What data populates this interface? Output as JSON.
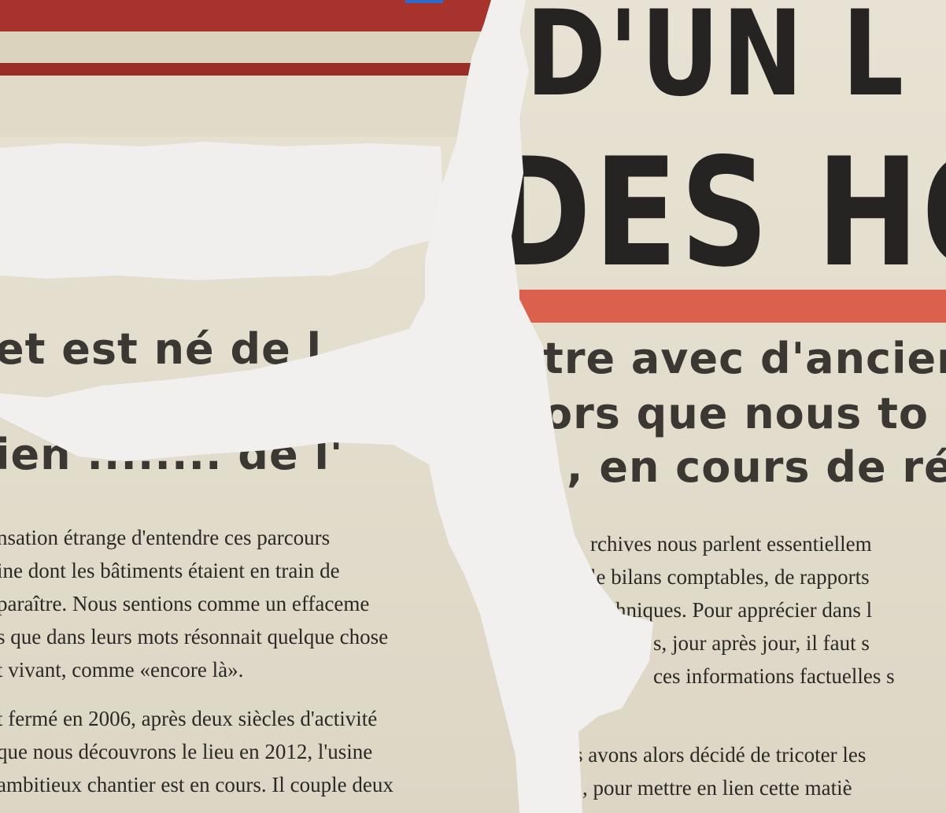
{
  "headline": {
    "line1": "D'UN L",
    "line2": "DES HO"
  },
  "subheads": {
    "left": [
      "et est né de l",
      "",
      "ien ........ de l'"
    ],
    "right": [
      "tre avec d'ancier",
      "ors que nous to",
      ", en cours de ré"
    ]
  },
  "body_left": [
    "nsation étrange d'entendre ces parcours",
    "ine dont les bâtiments étaient en train de",
    "paraître. Nous sentions comme un effaceme",
    "s que dans leurs mots résonnait quelque chose",
    "t vivant, comme «encore là».",
    "t fermé en 2006, après deux siècles d'activité",
    "que nous découvrons le lieu en 2012, l'usine",
    "ambitieux chantier est en cours. Il couple deux"
  ],
  "body_right": [
    "rchives nous parlent essentiellem",
    "le bilans comptables, de rapports",
    "chniques. Pour apprécier dans l",
    "s, jour après jour, il faut s",
    "ces informations factuelles s",
    "s avons alors décidé de tricoter les",
    ", pour mettre en lien cette matiè"
  ],
  "colors": {
    "paper": "#e4dece",
    "ink": "#262422",
    "red": "#d9533f",
    "torn_edge": "#f3f2f1"
  }
}
